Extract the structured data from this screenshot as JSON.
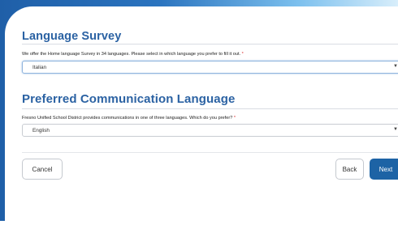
{
  "language_survey": {
    "title": "Language Survey",
    "question": "We offer the Home language Survey in 34 languages. Please select in which language you prefer to fill it out.",
    "required_mark": "*",
    "selected_value": "Italian"
  },
  "communication_language": {
    "title": "Preferred Communication Language",
    "question": "Fresno Unified School District provides communications in one of three languages. Which do you prefer?",
    "required_mark": "*",
    "selected_value": "English"
  },
  "actions": {
    "cancel_label": "Cancel",
    "back_label": "Back",
    "next_label": "Next"
  },
  "icons": {
    "dropdown_caret": "chevron-down-icon"
  },
  "colors": {
    "title": "#2b62a3",
    "primary_button": "#1d63a5",
    "required": "#dd3333"
  }
}
